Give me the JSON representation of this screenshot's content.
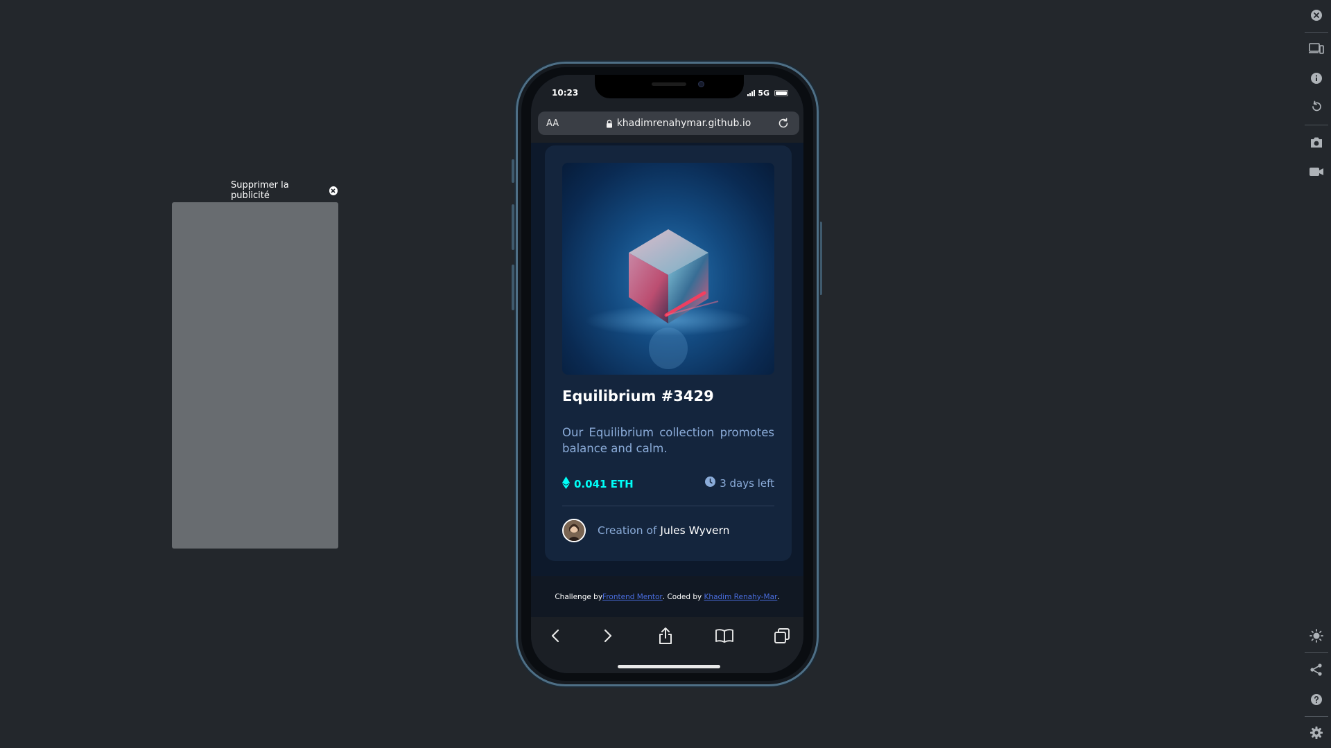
{
  "ad": {
    "remove_label": "Supprimer la publicité"
  },
  "phone": {
    "status": {
      "time": "10:23",
      "network": "5G"
    },
    "browser": {
      "text_size_label": "AA",
      "url": "khadimrenahymar.github.io"
    },
    "card": {
      "title": "Equilibrium #3429",
      "description": "Our Equilibrium collection promotes balance and calm.",
      "price": "0.041 ETH",
      "time_left": "3 days left",
      "creator_prefix": "Creation of",
      "creator_name": "Jules Wyvern"
    },
    "footer": {
      "challenge_prefix": "Challenge by",
      "challenge_link": "Frontend Mentor",
      "coded_prefix": ". Coded by",
      "coded_link": "Khadim Renahy-Mar",
      "suffix": "."
    }
  },
  "colors": {
    "page_bg": "#23272c",
    "card_bg": "#14253d",
    "accent_cyan": "#00fff8",
    "soft_blue": "#8bacd9"
  },
  "toolbar_icons": [
    "back-icon",
    "forward-icon",
    "share-icon",
    "bookmarks-icon",
    "tabs-icon"
  ],
  "rail_icons": [
    "close-icon",
    "device-icon",
    "info-icon",
    "rotate-icon",
    "camera-icon",
    "video-icon",
    "brightness-icon",
    "share-icon",
    "help-icon",
    "settings-icon"
  ]
}
